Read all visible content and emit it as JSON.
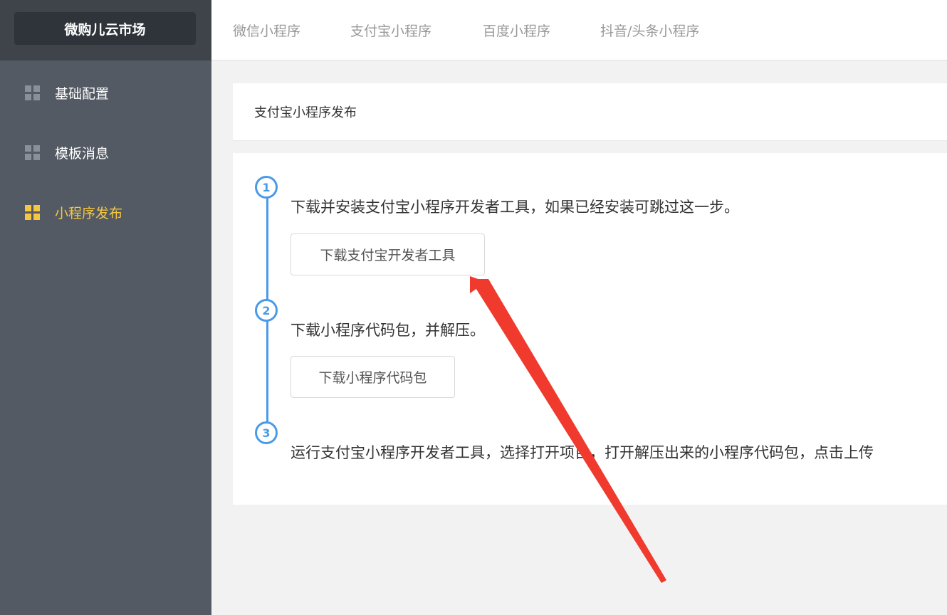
{
  "sidebar": {
    "logo": "微购儿云市场",
    "items": [
      {
        "label": "基础配置",
        "active": false
      },
      {
        "label": "模板消息",
        "active": false
      },
      {
        "label": "小程序发布",
        "active": true
      }
    ]
  },
  "topbar": {
    "tabs": [
      {
        "label": "微信小程序"
      },
      {
        "label": "支付宝小程序"
      },
      {
        "label": "百度小程序"
      },
      {
        "label": "抖音/头条小程序"
      }
    ]
  },
  "page": {
    "title": "支付宝小程序发布",
    "steps": [
      {
        "number": "1",
        "text": "下载并安装支付宝小程序开发者工具，如果已经安装可跳过这一步。",
        "button": "下载支付宝开发者工具"
      },
      {
        "number": "2",
        "text": "下载小程序代码包，并解压。",
        "button": "下载小程序代码包"
      },
      {
        "number": "3",
        "text": "运行支付宝小程序开发者工具，选择打开项目，打开解压出来的小程序代码包，点击上传"
      }
    ]
  },
  "colors": {
    "sidebar_bg": "#535a63",
    "active_menu": "#f5c644",
    "step_blue": "#4a9ae8",
    "annotation_arrow": "#f03a2e"
  }
}
